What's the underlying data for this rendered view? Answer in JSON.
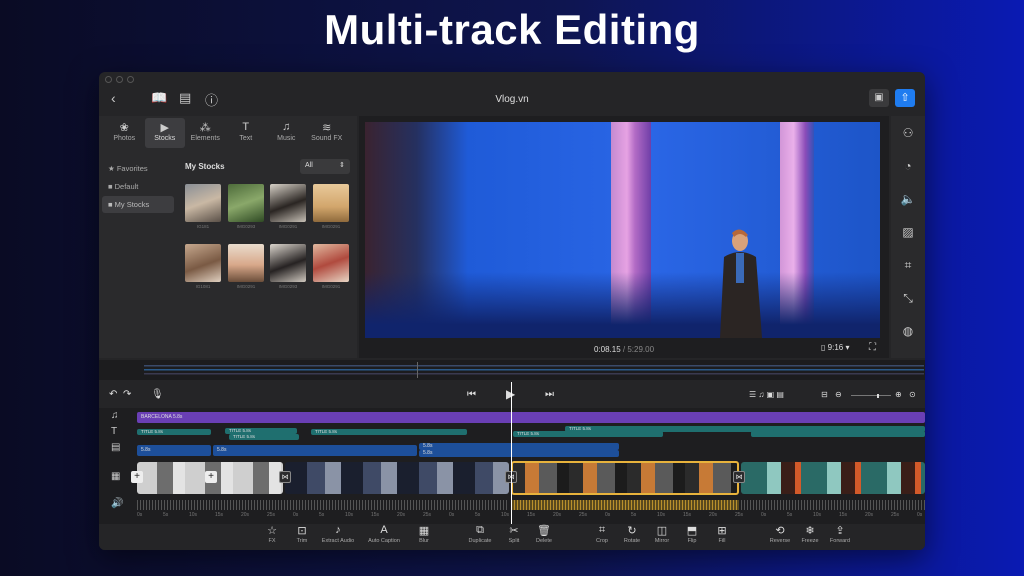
{
  "headline": "Multi-track Editing",
  "app": {
    "title": "Vlog.vn",
    "colors": {
      "accent": "#1f7cf0",
      "music": "#6a3fb5",
      "title": "#1f6f6f",
      "selection": "#e8b33c"
    }
  },
  "topbar": {
    "icons": [
      "back-icon",
      "book-icon",
      "layout-icon",
      "help-icon"
    ],
    "save_icon": "save-icon",
    "export_icon": "export-icon"
  },
  "tabs": [
    {
      "label": "Photos",
      "icon": "❀"
    },
    {
      "label": "Stocks",
      "icon": "▶"
    },
    {
      "label": "Elements",
      "icon": "⁂"
    },
    {
      "label": "Text",
      "icon": "T"
    },
    {
      "label": "Music",
      "icon": "♫"
    },
    {
      "label": "Sound FX",
      "icon": "≋"
    }
  ],
  "side_nav": [
    {
      "label": "Favorites",
      "icon": "★"
    },
    {
      "label": "Default",
      "icon": "■"
    },
    {
      "label": "My Stocks",
      "icon": "■"
    }
  ],
  "stocks": {
    "title": "My Stocks",
    "filter": "All",
    "thumbs": [
      {
        "label": "IG181"
      },
      {
        "label": "IMG0293"
      },
      {
        "label": "IMG0291"
      },
      {
        "label": "IMG0291"
      },
      {
        "label": "IG1081"
      },
      {
        "label": "IMG0291"
      },
      {
        "label": "IMG0293"
      },
      {
        "label": "IMG0291"
      }
    ]
  },
  "preview": {
    "current": "0:08.15",
    "total": "5:29.00",
    "ratio": "9:16"
  },
  "timeline": {
    "music_label": "BARCELONA",
    "music_duration": "5.8s",
    "title_label": "TITLE",
    "title_duration": "5.8s",
    "clip_duration": "5.8s",
    "ruler": [
      "0s",
      "5s",
      "10s",
      "15s",
      "20s",
      "25s",
      "0s",
      "5s",
      "10s",
      "15s",
      "20s",
      "25s",
      "0s",
      "5s",
      "10s",
      "15s",
      "20s",
      "25s",
      "0s",
      "5s",
      "10s",
      "15s",
      "20s",
      "25s",
      "0s",
      "5s",
      "10s",
      "15s",
      "20s",
      "25s",
      "0s"
    ]
  },
  "toolbar": [
    {
      "label": "FX",
      "icon": "☆"
    },
    {
      "label": "Trim",
      "icon": "⊡"
    },
    {
      "label": "Extract Audio",
      "icon": "♪"
    },
    {
      "label": "Auto Caption",
      "icon": "A"
    },
    {
      "label": "Blur",
      "icon": "▦"
    },
    {
      "label": "Duplicate",
      "icon": "⧉"
    },
    {
      "label": "Split",
      "icon": "✂"
    },
    {
      "label": "Delete",
      "icon": "🗑"
    },
    {
      "label": "Crop",
      "icon": "⌗"
    },
    {
      "label": "Rotate",
      "icon": "↻"
    },
    {
      "label": "Mirror",
      "icon": "◫"
    },
    {
      "label": "Flip",
      "icon": "⬒"
    },
    {
      "label": "Fill",
      "icon": "⊞"
    },
    {
      "label": "Reverse",
      "icon": "⟲"
    },
    {
      "label": "Freeze",
      "icon": "❄"
    },
    {
      "label": "Forward",
      "icon": "⇪"
    }
  ]
}
